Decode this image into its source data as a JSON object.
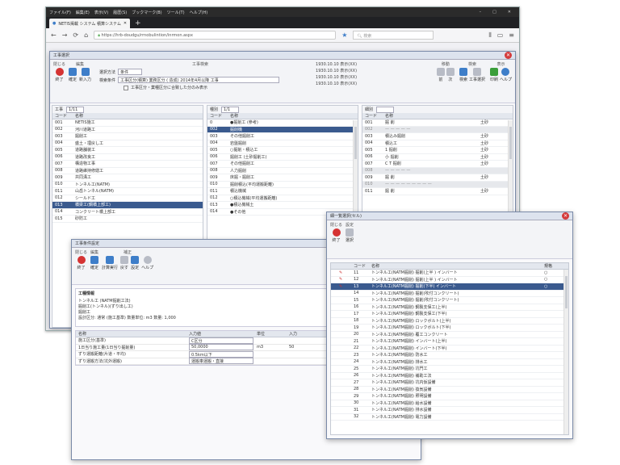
{
  "os_menu": [
    "ファイル(F)",
    "編集(E)",
    "表示(V)",
    "履歴(S)",
    "ブックマーク(B)",
    "ツール(T)",
    "ヘルプ(H)"
  ],
  "window_controls": [
    "–",
    "□",
    "✕"
  ],
  "browser": {
    "tab_title": "NETIS掲載 システム 積算システム",
    "new_tab": "+",
    "url": "https://hrb-doudgu/rrnobulintion/inrmon.aspx",
    "search_placeholder": "検索"
  },
  "main_window": {
    "title": "工事選択",
    "ribbon": {
      "groups": [
        {
          "title": "閉じる",
          "buttons": [
            "終了"
          ]
        },
        {
          "title": "編集",
          "buttons": [
            "確定",
            "新入力"
          ]
        }
      ],
      "field_label_1": "選択方法",
      "field_value_1": "条件",
      "field_label_2": "検索条件",
      "field_value_2": "工事区分(積算) 業務区分 ( 造成) 2014年4月以降 工事",
      "checkbox_label": "工事区分・業種区分に合致した分のみ表示",
      "center_title": "工事検索",
      "info_lines": [
        "1930.10.10  表示(XX)",
        "1930.10.10  表示(XX)",
        "1930.10.10  表示(XX)",
        "1930.10.10  表示(XX)"
      ],
      "right_title": "最近のグループ",
      "right_groups": [
        {
          "title": "移動",
          "buttons": [
            "前",
            "次"
          ]
        },
        {
          "title": "検索",
          "buttons": [
            "検索",
            "工事選択"
          ]
        },
        {
          "title": "表示",
          "buttons": [
            "印刷",
            "ヘルプ"
          ]
        }
      ]
    },
    "panel1": {
      "tab_label": "工事",
      "tab_value": "1/11",
      "headers": [
        "コード",
        "名称"
      ],
      "rows": [
        [
          "001",
          "NETIS施工"
        ],
        [
          "002",
          "河川道路工"
        ],
        [
          "003",
          "掘削工"
        ],
        [
          "004",
          "盛土・埋戻し工"
        ],
        [
          "005",
          "道路舗装工"
        ],
        [
          "006",
          "道路改良工"
        ],
        [
          "007",
          "構造物工事"
        ],
        [
          "008",
          "道路維持修繕工"
        ],
        [
          "009",
          "共同溝工"
        ],
        [
          "010",
          "トンネル工(NATM)"
        ],
        [
          "011",
          "山岳トンネル(NATM)"
        ],
        [
          "012",
          "シールド工"
        ],
        [
          "013",
          "橋梁工(鋼橋上部工)"
        ],
        [
          "014",
          "コンクリート橋上部工"
        ],
        [
          "015",
          "砂防工"
        ]
      ],
      "highlight_index": 12
    },
    "panel2": {
      "tab_label": "種別",
      "tab_value": "1/1",
      "headers": [
        "コード",
        "名称"
      ],
      "rows": [
        [
          "0",
          "●掘削工 (参考)"
        ],
        [
          "002",
          "掘削機"
        ],
        [
          "003",
          "その他掘削工"
        ],
        [
          "004",
          "岩盤掘削"
        ],
        [
          "005",
          "○掘削・積込工"
        ],
        [
          "006",
          "掘削工 (土砂掘削工)"
        ],
        [
          "007",
          "その他掘削工"
        ],
        [
          "008",
          "人力掘削"
        ],
        [
          "009",
          "床掘・掘削工"
        ],
        [
          "010",
          "掘削積込(平均運搬距離)"
        ],
        [
          "011",
          "積込機械"
        ],
        [
          "012",
          "○積込機械(平均運搬距離)"
        ],
        [
          "013",
          "●積込機械土"
        ],
        [
          "014",
          "●その他"
        ]
      ],
      "highlight_index": 1
    },
    "panel3": {
      "tab_label": "細別",
      "tab_value": "",
      "headers": [
        "コード",
        "名称"
      ],
      "rows": [
        [
          "001",
          "掘 削",
          "土砂"
        ],
        [
          "002",
          "— — — — —",
          ""
        ],
        [
          "003",
          "積込み掘削",
          "土砂"
        ],
        [
          "004",
          "積込工",
          "土砂"
        ],
        [
          "005",
          "1 掘削",
          "土砂"
        ],
        [
          "006",
          "小 掘削",
          "土砂"
        ],
        [
          "007",
          "C T 掘削",
          "土砂"
        ],
        [
          "008",
          "— — — — —",
          ""
        ],
        [
          "009",
          "掘 削",
          "土砂"
        ],
        [
          "010",
          "— — — — — — — — —",
          ""
        ],
        [
          "011",
          "掘 削",
          "土砂"
        ]
      ],
      "gray_indices": [
        1,
        7,
        9
      ]
    }
  },
  "left_dialog": {
    "title": "工事条件設定",
    "ribbon_groups": [
      {
        "title": "閉じる",
        "buttons": [
          "終了"
        ]
      },
      {
        "title": "編集",
        "buttons": [
          "確定"
        ]
      },
      {
        "title": "補正",
        "buttons": [
          "計算実行",
          "戻す",
          "設定",
          "ヘルプ"
        ]
      }
    ],
    "section_title": "工種情報",
    "desc_lines": [
      "トンネル工 (NATM掘削工法)",
      "掘削工(トンネル)(ずり出し工)",
      "掘削工",
      "設計区分: 通常 (施工基準)  数量単位: m3  数量: 1,000"
    ],
    "table_headers": [
      "名称",
      "入力値",
      "単位",
      "入力"
    ],
    "rows": [
      [
        "施工区分(基準)",
        "C区分",
        "",
        ""
      ],
      [
        "1日当り施工量(1日当り掘削量)",
        "50,0000",
        "m3",
        "50"
      ],
      [
        "ずり運搬距離(片道・平均)",
        "0.5km以下",
        "",
        ""
      ],
      [
        "ずり運搬方法(坑外運搬)",
        "運搬車運搬・直接",
        "",
        ""
      ]
    ]
  },
  "right_dialog": {
    "title": "細一覧選択(セル)",
    "ribbon_groups": [
      {
        "title": "閉じる",
        "buttons": [
          "終了"
        ]
      },
      {
        "title": "設定",
        "buttons": [
          "選択"
        ]
      }
    ],
    "headers": [
      "コード",
      "名称",
      "規格"
    ],
    "rows": [
      [
        "11",
        "トンネル工(NATM掘削) 掘削(上半 ) インバート",
        "○"
      ],
      [
        "12",
        "トンネル工(NATM掘削) 掘削(上半 ) インバート",
        "○"
      ],
      [
        "13",
        "トンネル工(NATM掘削) 掘削(下半) インバート",
        "○"
      ],
      [
        "14",
        "トンネル工(NATM掘削) 掘削(吹付コンクリート)",
        ""
      ],
      [
        "15",
        "トンネル工(NATM掘削) 掘削(吹付コンクリート)",
        ""
      ],
      [
        "16",
        "トンネル工(NATM掘削) 鋼製支保工(上半)",
        ""
      ],
      [
        "17",
        "トンネル工(NATM掘削) 鋼製支保工(下半)",
        ""
      ],
      [
        "18",
        "トンネル工(NATM掘削) ロックボルト(上半)",
        ""
      ],
      [
        "19",
        "トンネル工(NATM掘削) ロックボルト(下半)",
        ""
      ],
      [
        "20",
        "トンネル工(NATM掘削) 覆工コンクリート",
        ""
      ],
      [
        "21",
        "トンネル工(NATM掘削) インバート(上半)",
        ""
      ],
      [
        "22",
        "トンネル工(NATM掘削) インバート(下半)",
        ""
      ],
      [
        "23",
        "トンネル工(NATM掘削) 防水工",
        ""
      ],
      [
        "24",
        "トンネル工(NATM掘削) 排水工",
        ""
      ],
      [
        "25",
        "トンネル工(NATM掘削) 坑門工",
        ""
      ],
      [
        "26",
        "トンネル工(NATM掘削) 補助工法",
        ""
      ],
      [
        "27",
        "トンネル工(NATM掘削) 坑内仮設備",
        ""
      ],
      [
        "28",
        "トンネル工(NATM掘削) 換気設備",
        ""
      ],
      [
        "29",
        "トンネル工(NATM掘削) 照明設備",
        ""
      ],
      [
        "30",
        "トンネル工(NATM掘削) 給水設備",
        ""
      ],
      [
        "31",
        "トンネル工(NATM掘削) 排水設備",
        ""
      ],
      [
        "32",
        "トンネル工(NATM掘削) 電力設備",
        ""
      ]
    ],
    "highlight_index": 2,
    "marked_indices": [
      0,
      1,
      2
    ]
  }
}
